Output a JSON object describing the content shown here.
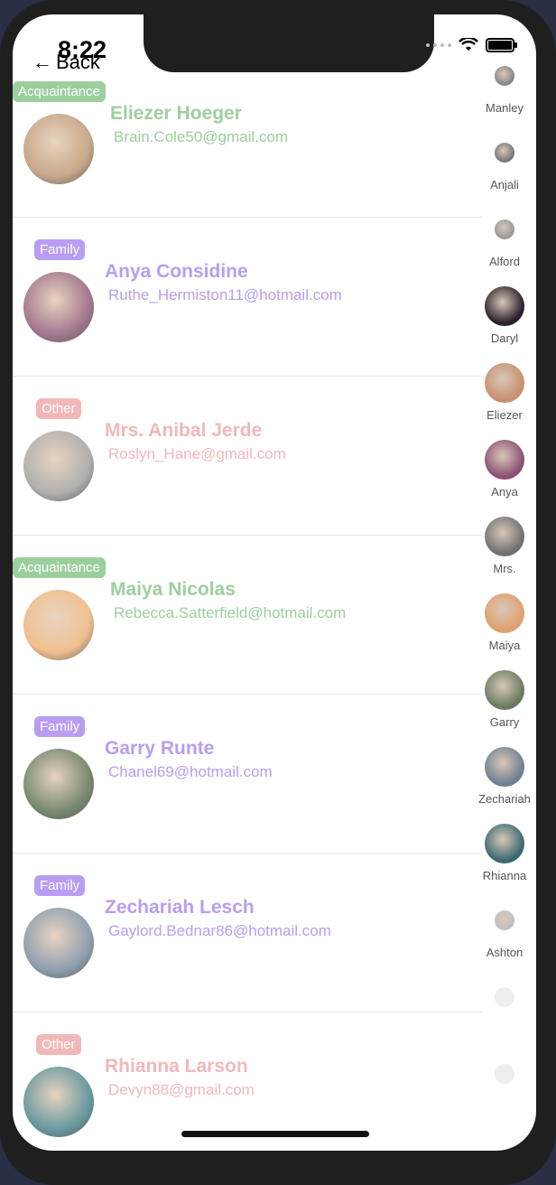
{
  "status": {
    "time": "8:22"
  },
  "nav": {
    "back_label": "Back"
  },
  "colors": {
    "acquaintance": "#9ccf9e",
    "family": "#b99df2",
    "other": "#f2b8b8"
  },
  "contacts": [
    {
      "tag": "Acquaintance",
      "name": "Eliezer Hoeger",
      "email": "Brain.Cole50@gmail.com",
      "type": "acquaintance"
    },
    {
      "tag": "Family",
      "name": "Anya Considine",
      "email": "Ruthe_Hermiston11@hotmail.com",
      "type": "family"
    },
    {
      "tag": "Other",
      "name": "Mrs. Anibal Jerde",
      "email": "Roslyn_Hane@gmail.com",
      "type": "other"
    },
    {
      "tag": "Acquaintance",
      "name": "Maiya Nicolas",
      "email": "Rebecca.Satterfield@hotmail.com",
      "type": "acquaintance"
    },
    {
      "tag": "Family",
      "name": "Garry Runte",
      "email": "Chanel69@hotmail.com",
      "type": "family"
    },
    {
      "tag": "Family",
      "name": "Zechariah Lesch",
      "email": "Gaylord.Bednar86@hotmail.com",
      "type": "family"
    },
    {
      "tag": "Other",
      "name": "Rhianna Larson",
      "email": "Devyn88@gmail.com",
      "type": "other"
    }
  ],
  "side_index": [
    {
      "label": "Manley"
    },
    {
      "label": "Anjali"
    },
    {
      "label": "Alford"
    },
    {
      "label": "Daryl"
    },
    {
      "label": "Eliezer"
    },
    {
      "label": "Anya"
    },
    {
      "label": "Mrs."
    },
    {
      "label": "Maiya"
    },
    {
      "label": "Garry"
    },
    {
      "label": "Zechariah"
    },
    {
      "label": "Rhianna"
    },
    {
      "label": "Ashton"
    }
  ]
}
